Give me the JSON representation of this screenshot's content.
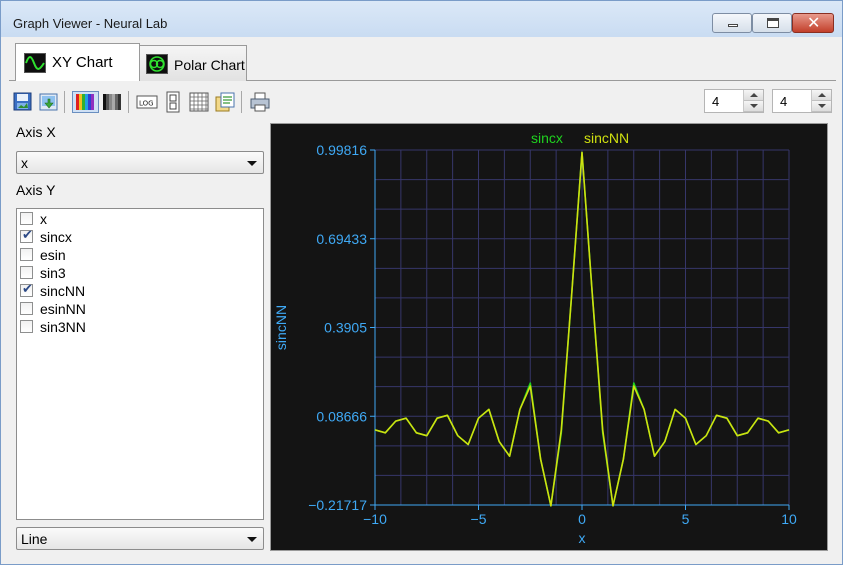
{
  "window": {
    "title": "Graph Viewer - Neural Lab"
  },
  "tabs": [
    {
      "label": "XY Chart",
      "icon": "xy-chart-icon",
      "active": true
    },
    {
      "label": "Polar Chart",
      "icon": "polar-chart-icon",
      "active": false
    }
  ],
  "toolbar": {
    "buttons": [
      "save-image-icon",
      "export-icon",
      "color-palette-icon",
      "grayscale-palette-icon",
      "log-scale-icon",
      "scale-settings-icon",
      "grid-icon",
      "copy-data-icon",
      "print-icon"
    ],
    "spinners": [
      {
        "value": "4"
      },
      {
        "value": "4"
      }
    ]
  },
  "left_panel": {
    "axis_x_label": "Axis X",
    "axis_x_selected": "x",
    "axis_y_label": "Axis Y",
    "axis_y_items": [
      {
        "label": "x",
        "checked": false
      },
      {
        "label": "sincx",
        "checked": true
      },
      {
        "label": "esin",
        "checked": false
      },
      {
        "label": "sin3",
        "checked": false
      },
      {
        "label": "sincNN",
        "checked": true
      },
      {
        "label": "esinNN",
        "checked": false
      },
      {
        "label": "sin3NN",
        "checked": false
      }
    ],
    "plot_style_selected": "Line"
  },
  "colors": {
    "plot_background": "#141414",
    "grid": "#36366a",
    "axis_text": "#3fa9f5",
    "series_sincx": "#1fd21f",
    "series_sincNN": "#cfe010"
  },
  "chart_data": {
    "type": "line",
    "title": "",
    "xlabel": "x",
    "ylabel": "sincNN",
    "xlim": [
      -10,
      10
    ],
    "ylim": [
      -0.21717,
      0.99816
    ],
    "x_ticks": [
      "−10",
      "−5",
      "0",
      "5",
      "10"
    ],
    "y_ticks": [
      "−0.21717",
      "0.08666",
      "0.3905",
      "0.69433",
      "0.99816"
    ],
    "grid": true,
    "legend": "top-center",
    "series": [
      {
        "name": "sincx",
        "x": [
          -10,
          -9.5,
          -9,
          -8.5,
          -8,
          -7.5,
          -7,
          -6.5,
          -6,
          -5.5,
          -5,
          -4.5,
          -4,
          -3.5,
          -3,
          -2.5,
          -2,
          -1.5,
          -1,
          -0.5,
          0,
          0.5,
          1,
          1.5,
          2,
          2.5,
          3,
          3.5,
          4,
          4.5,
          5,
          5.5,
          6,
          6.5,
          7,
          7.5,
          8,
          8.5,
          9,
          9.5,
          10
        ],
        "y": [
          0.04,
          0.03,
          0.07,
          0.08,
          0.03,
          0.02,
          0.08,
          0.09,
          0.02,
          -0.01,
          0.08,
          0.11,
          0.0,
          -0.05,
          0.11,
          0.2,
          -0.06,
          -0.22,
          0.03,
          0.5,
          0.99,
          0.5,
          0.03,
          -0.22,
          -0.06,
          0.2,
          0.11,
          -0.05,
          0.0,
          0.11,
          0.08,
          -0.01,
          0.02,
          0.09,
          0.08,
          0.02,
          0.03,
          0.08,
          0.07,
          0.03,
          0.04
        ]
      },
      {
        "name": "sincNN",
        "x": [
          -10,
          -9.5,
          -9,
          -8.5,
          -8,
          -7.5,
          -7,
          -6.5,
          -6,
          -5.5,
          -5,
          -4.5,
          -4,
          -3.5,
          -3,
          -2.5,
          -2,
          -1.5,
          -1,
          -0.5,
          0,
          0.5,
          1,
          1.5,
          2,
          2.5,
          3,
          3.5,
          4,
          4.5,
          5,
          5.5,
          6,
          6.5,
          7,
          7.5,
          8,
          8.5,
          9,
          9.5,
          10
        ],
        "y": [
          0.04,
          0.03,
          0.07,
          0.08,
          0.03,
          0.02,
          0.08,
          0.09,
          0.02,
          -0.01,
          0.08,
          0.11,
          0.0,
          -0.05,
          0.11,
          0.19,
          -0.06,
          -0.22,
          0.04,
          0.5,
          0.99,
          0.5,
          0.04,
          -0.22,
          -0.06,
          0.19,
          0.11,
          -0.05,
          0.0,
          0.11,
          0.08,
          -0.01,
          0.02,
          0.09,
          0.08,
          0.02,
          0.03,
          0.08,
          0.07,
          0.03,
          0.04
        ]
      }
    ]
  }
}
